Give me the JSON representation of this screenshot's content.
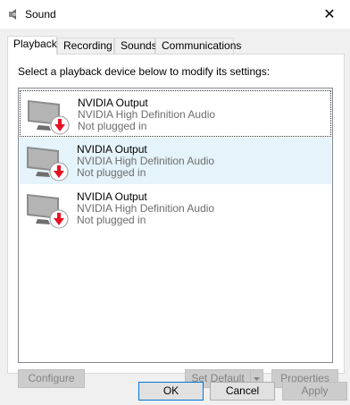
{
  "window": {
    "title": "Sound",
    "close_symbol": "✕"
  },
  "tabs": [
    {
      "label": "Playback"
    },
    {
      "label": "Recording"
    },
    {
      "label": "Sounds"
    },
    {
      "label": "Communications"
    }
  ],
  "playback": {
    "instruction": "Select a playback device below to modify its settings:",
    "devices": [
      {
        "name": "NVIDIA Output",
        "description": "NVIDIA High Definition Audio",
        "status": "Not plugged in"
      },
      {
        "name": "NVIDIA Output",
        "description": "NVIDIA High Definition Audio",
        "status": "Not plugged in"
      },
      {
        "name": "NVIDIA Output",
        "description": "NVIDIA High Definition Audio",
        "status": "Not plugged in"
      }
    ],
    "buttons": {
      "configure": "Configure",
      "set_default": "Set Default",
      "properties": "Properties"
    }
  },
  "footer": {
    "ok": "OK",
    "cancel": "Cancel",
    "apply": "Apply"
  },
  "colors": {
    "accent": "#0078d7",
    "disabled_text": "#838383",
    "status_arrow": "#e81123"
  }
}
